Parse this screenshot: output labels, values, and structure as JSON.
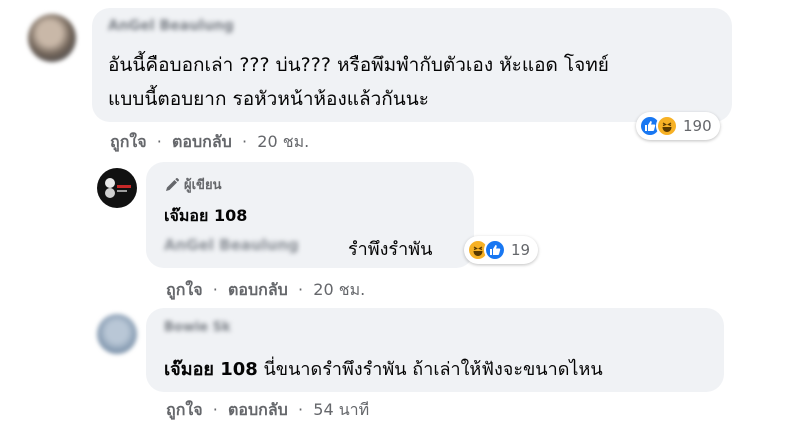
{
  "comments": [
    {
      "author": "AnGel Beaulung",
      "lines": [
        "อันนี้คือบอกเล่า ??? บ่น??? หรือพึมพำกับตัวเอง หัะแอด โจทย์",
        "แบบนี้ตอบยาก รอหัวหน้าห้องแล้วกันนะ"
      ],
      "actions": {
        "like": "ถูกใจ",
        "reply": "ตอบกลับ",
        "time": "20 ชม."
      },
      "reactions": {
        "count": "190",
        "icons": [
          "like-icon",
          "haha-icon"
        ]
      }
    },
    {
      "badge": "ผู้เขียน",
      "author": "เจ๊มอย 108",
      "mention": "AnGel Beaulung",
      "text": "รำพึงรำพัน",
      "actions": {
        "like": "ถูกใจ",
        "reply": "ตอบกลับ",
        "time": "20 ชม."
      },
      "reactions": {
        "count": "19",
        "icons": [
          "haha-icon",
          "like-icon"
        ]
      }
    },
    {
      "author": "Bowie Sk",
      "mention": "เจ๊มอย 108",
      "text": "นี่ขนาดรำพึงรำพัน ถ้าเล่าให้ฟังจะขนาดไหน",
      "actions": {
        "like": "ถูกใจ",
        "reply": "ตอบกลับ",
        "time": "54 นาที"
      }
    }
  ],
  "colors": {
    "bubble": "#f0f2f5",
    "like_blue": "#1877f2",
    "haha_yellow": "#f7b125",
    "meta_gray": "#65676b"
  }
}
